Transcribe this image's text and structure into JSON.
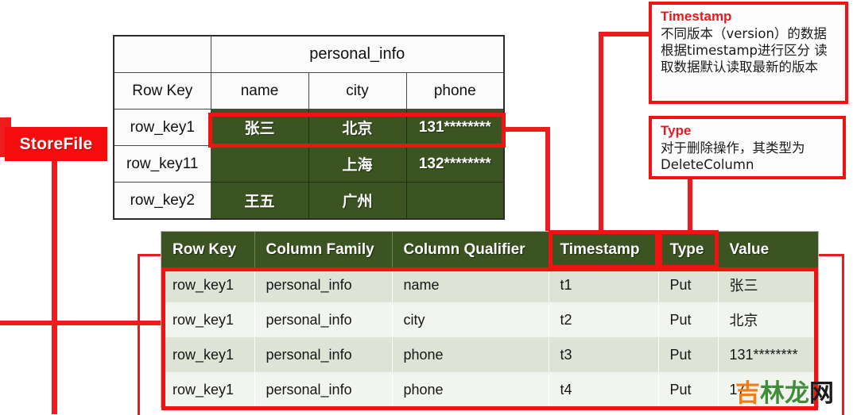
{
  "labels": {
    "storefile": "StoreFile"
  },
  "top_table": {
    "column_family_header": "personal_info",
    "headers": [
      "Row Key",
      "name",
      "city",
      "phone"
    ],
    "rows": [
      {
        "row_key": "row_key1",
        "name": "张三",
        "city": "北京",
        "phone": "131********"
      },
      {
        "row_key": "row_key11",
        "name": "",
        "city": "上海",
        "phone": "132********"
      },
      {
        "row_key": "row_key2",
        "name": "王五",
        "city": "广州",
        "phone": ""
      }
    ]
  },
  "bottom_table": {
    "headers": [
      "Row Key",
      "Column Family",
      "Column Qualifier",
      "Timestamp",
      "Type",
      "Value"
    ],
    "rows": [
      {
        "row_key": "row_key1",
        "column_family": "personal_info",
        "column_qualifier": "name",
        "timestamp": "t1",
        "type": "Put",
        "value": "张三"
      },
      {
        "row_key": "row_key1",
        "column_family": "personal_info",
        "column_qualifier": "city",
        "timestamp": "t2",
        "type": "Put",
        "value": "北京"
      },
      {
        "row_key": "row_key1",
        "column_family": "personal_info",
        "column_qualifier": "phone",
        "timestamp": "t3",
        "type": "Put",
        "value": "131********"
      },
      {
        "row_key": "row_key1",
        "column_family": "personal_info",
        "column_qualifier": "phone",
        "timestamp": "t4",
        "type": "Put",
        "value": "17"
      }
    ]
  },
  "notes": {
    "timestamp": {
      "title": "Timestamp",
      "body": "不同版本（version）的数据根据timestamp进行区分 读取数据默认读取最新的版本"
    },
    "type": {
      "title": "Type",
      "body": "对于删除操作，其类型为 DeleteColumn"
    }
  },
  "watermark": {
    "c1": "吉",
    "c2": "林",
    "c3": "龙",
    "c4": "网"
  },
  "colors": {
    "accent_red": "#f21212",
    "storefile_red": "#f60c0c",
    "table_green": "#3c5322",
    "note_title_red": "#e8191f",
    "row_odd": "#dde4d6",
    "row_even": "#f2f5ef"
  }
}
